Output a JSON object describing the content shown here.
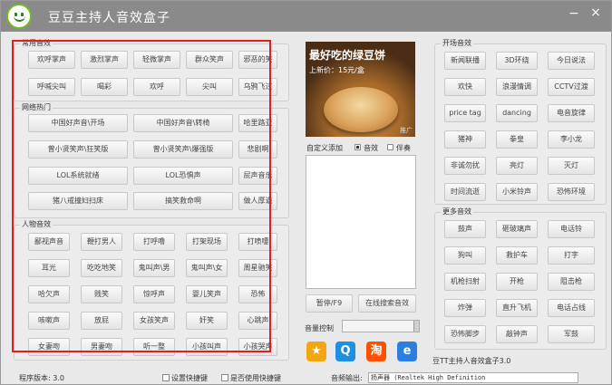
{
  "window": {
    "title": "豆豆主持人音效盒子",
    "minimize": "−",
    "close": "×"
  },
  "left_groups": [
    {
      "label": "常用音效",
      "buttons": [
        "欢呼掌声",
        "激烈掌声",
        "轻微掌声",
        "群众笑声",
        "邪恶的笑",
        "呼喊尖叫",
        "喝彩",
        "欢呼",
        "尖叫",
        "乌鸦飞过"
      ]
    },
    {
      "label": "网络热门",
      "buttons": [
        "中国好声音\\开场",
        "中国好声音\\转椅",
        "哈里路亚",
        "曾小贤笑声\\狂笑版",
        "曾小贤笑声\\爆强版",
        "悲剧啊",
        "LOL系统就绪",
        "LOL恐惧声",
        "屁声音乐",
        "猪八戒撞妇扫床",
        "搞笑救命啊",
        "做人厚道"
      ]
    },
    {
      "label": "人物音效",
      "buttons": [
        "鄙视声音",
        "鞭打男人",
        "打呼噜",
        "打架现场",
        "打喷嚏",
        "耳光",
        "吃吃地笑",
        "鬼叫声\\男",
        "鬼叫声\\女",
        "周星驰笑",
        "哈欠声",
        "贱笑",
        "惊呼声",
        "婴儿笑声",
        "恐怖",
        "咳嗽声",
        "放屁",
        "女孩笑声",
        "奸笑",
        "心跳声",
        "女妻吻",
        "男妻吻",
        "听一整",
        "小孩叫声",
        "小孩哭声"
      ]
    }
  ],
  "ad": {
    "title": "最好吃的绿豆饼",
    "price": "上新价：15元/盒",
    "tag": "推广"
  },
  "custom": {
    "label": "自定义添加",
    "radio_effect": "音效",
    "radio_bgm": "伴奏"
  },
  "controls": {
    "pause": "暂停/F9",
    "search_online": "在线搜索音效",
    "volume_label": "音量控制",
    "volume": 1.0
  },
  "shortcuts": [
    {
      "icon": "star-icon",
      "glyph": "★",
      "color": "#f2a612"
    },
    {
      "icon": "qq-icon",
      "glyph": "Q",
      "color": "#1f8fe0"
    },
    {
      "icon": "taobao-icon",
      "glyph": "淘",
      "color": "#ff5000"
    },
    {
      "icon": "ie-icon",
      "glyph": "e",
      "color": "#2c7ee0"
    }
  ],
  "right_groups": [
    {
      "label": "开场音效",
      "buttons": [
        "新闻联播",
        "3D环绕",
        "今日说法",
        "欢快",
        "浪漫情调",
        "CCTV过渡",
        "price tag",
        "dancing",
        "电音旋律",
        "猪神",
        "拳皇",
        "李小龙",
        "非诚勿扰",
        "亮灯",
        "灭灯",
        "时间流逝",
        "小米铃声",
        "恐怖环境"
      ]
    },
    {
      "label": "更多音效",
      "buttons": [
        "鼓声",
        "砸玻璃声",
        "电话铃",
        "狗叫",
        "救护车",
        "打字",
        "机枪扫射",
        "开枪",
        "阻击枪",
        "炸弹",
        "直升飞机",
        "电话占线",
        "恐怖脚步",
        "敲钟声",
        "军鼓"
      ]
    }
  ],
  "footer_text": "豆TT主持人音效盒子3.0",
  "status": {
    "version": "程序版本: 3.0",
    "set_hotkey": "设置快捷键",
    "use_hotkey": "是否使用快捷键",
    "audio_output": "音频输出:",
    "device": "扬声器 (Realtek High Definition"
  }
}
